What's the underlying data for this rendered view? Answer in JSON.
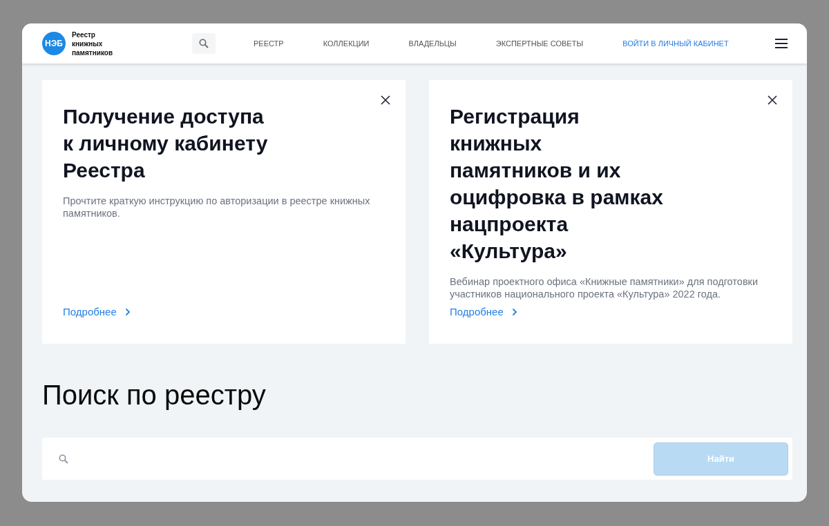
{
  "header": {
    "logo_badge": "НЭБ",
    "logo_text": "Реестр\nкнижных\nпамятников",
    "nav": [
      {
        "label": "РЕЕСТР",
        "kind": "section"
      },
      {
        "label": "КОЛЛЕКЦИИ",
        "kind": "section"
      },
      {
        "label": "ВЛАДЕЛЬЦЫ",
        "kind": "section"
      },
      {
        "label": "ЭКСПЕРТНЫЕ СОВЕТЫ",
        "kind": "section"
      },
      {
        "label": "ВОЙТИ В ЛИЧНЫЙ КАБИНЕТ",
        "kind": "login"
      }
    ]
  },
  "cards": [
    {
      "title": "Получение доступа\nк личному кабинету\nРеестра",
      "text": "Прочтите краткую инструкцию по авторизации в реестре книжных памятников.",
      "link": "Подробнее"
    },
    {
      "title": "Регистрация\nкнижных\nпамятников и их\nоцифровка в рамках\nнацпроекта\n«Культура»",
      "text": "Вебинар проектного офиса «Книжные памятники» для подготовки участников национального проекта «Культура» 2022 года.",
      "link": "Подробнее"
    }
  ],
  "search": {
    "heading": "Поиск по реестру",
    "button": "Найти",
    "button_disabled": true
  }
}
